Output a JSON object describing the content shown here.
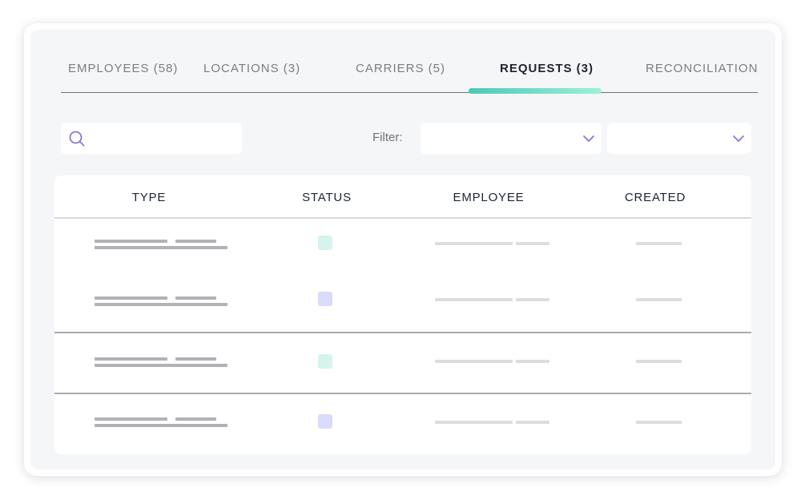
{
  "tabs": [
    {
      "label": "EMPLOYEES (58)",
      "active": false
    },
    {
      "label": "LOCATIONS (3)",
      "active": false
    },
    {
      "label": "CARRIERS (5)",
      "active": false
    },
    {
      "label": "REQUESTS (3)",
      "active": true
    },
    {
      "label": "RECONCILIATION",
      "active": false
    }
  ],
  "search": {
    "value": "",
    "placeholder": ""
  },
  "filter": {
    "label": "Filter:",
    "select_1_value": "",
    "select_2_value": ""
  },
  "table": {
    "columns": [
      "TYPE",
      "STATUS",
      "EMPLOYEE",
      "CREATED"
    ],
    "rows": [
      {
        "status_color": "#d6f4ee",
        "status": "teal"
      },
      {
        "status_color": "#d9dbfb",
        "status": "purple"
      },
      {
        "status_color": "#d6f4ee",
        "status": "teal"
      },
      {
        "status_color": "#d9dbfb",
        "status": "purple"
      }
    ]
  },
  "colors": {
    "accent": "#4cc9b5",
    "icon_purple": "#8a78d6",
    "text_dark": "#1d2430",
    "text_muted": "#7a7d84"
  },
  "icons": {
    "search": "search-icon",
    "dropdown": "chevron-down-icon"
  }
}
